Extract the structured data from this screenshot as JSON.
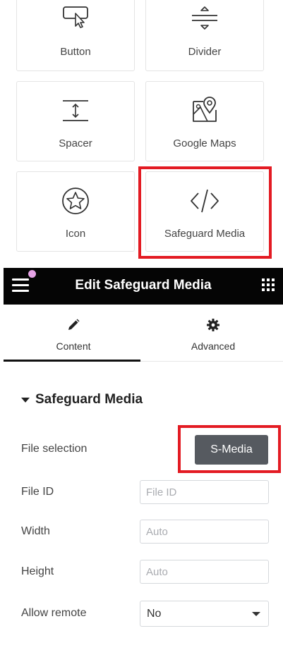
{
  "widgets": [
    {
      "label": "Button",
      "icon": "cursor-click-icon"
    },
    {
      "label": "Divider",
      "icon": "divider-icon"
    },
    {
      "label": "Spacer",
      "icon": "spacer-icon"
    },
    {
      "label": "Google Maps",
      "icon": "map-pin-icon"
    },
    {
      "label": "Icon",
      "icon": "star-circle-icon"
    },
    {
      "label": "Safeguard Media",
      "icon": "code-icon"
    }
  ],
  "header": {
    "title": "Edit Safeguard Media"
  },
  "tabs": [
    {
      "label": "Content",
      "icon": "pencil-icon",
      "active": true
    },
    {
      "label": "Advanced",
      "icon": "gear-icon",
      "active": false
    }
  ],
  "section": {
    "title": "Safeguard Media"
  },
  "controls": {
    "file_selection": {
      "label": "File selection",
      "button_label": "S-Media"
    },
    "file_id": {
      "label": "File ID",
      "placeholder": "File ID"
    },
    "width": {
      "label": "Width",
      "placeholder": "Auto"
    },
    "height": {
      "label": "Height",
      "placeholder": "Auto"
    },
    "allow_remote": {
      "label": "Allow remote",
      "value": "No"
    }
  },
  "colors": {
    "header_bg": "#050505",
    "highlight": "#e31b23",
    "button_bg": "#565a60",
    "notification_dot": "#e6a3e6"
  }
}
